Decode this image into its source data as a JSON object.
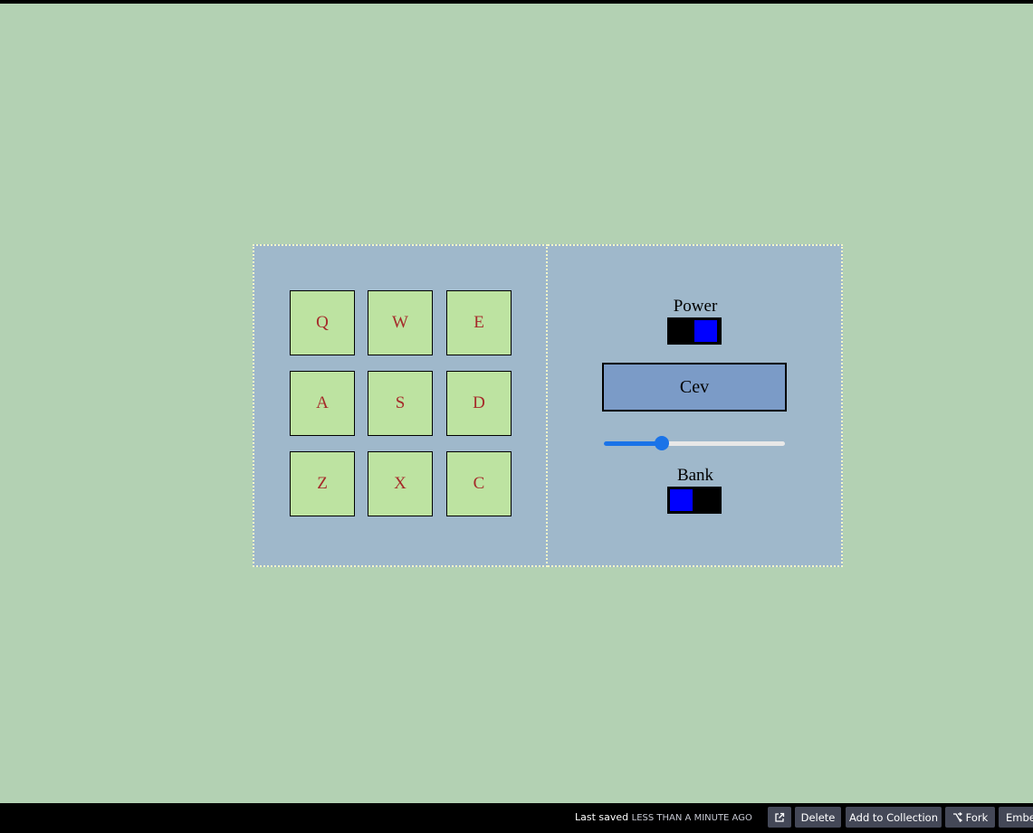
{
  "pads": [
    "Q",
    "W",
    "E",
    "A",
    "S",
    "D",
    "Z",
    "X",
    "C"
  ],
  "controls": {
    "power_label": "Power",
    "power_on": true,
    "display_text": "Cev",
    "volume": 0.32,
    "bank_label": "Bank",
    "bank_on": false
  },
  "footer": {
    "last_saved_label": "Last saved",
    "last_saved_value": "LESS THAN A MINUTE AGO",
    "delete_label": "Delete",
    "add_to_collection_label": "Add to Collection",
    "fork_label": "Fork",
    "embed_label": "Embe"
  },
  "colors": {
    "page_background": "#b3d1b3",
    "panel_background": "#9fb8cb",
    "pad_background": "#bde3a1",
    "pad_text": "#a52a2a",
    "display_background": "#7b9bc7",
    "toggle_knob": "#0000ff",
    "slider_accent": "#1a73e8"
  },
  "icons": {
    "external_link": "external-link-icon",
    "fork": "fork-icon"
  }
}
